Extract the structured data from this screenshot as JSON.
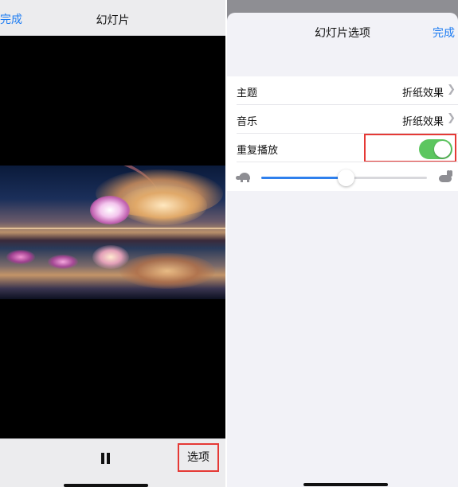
{
  "left": {
    "nav": {
      "done_label": "完成",
      "title": "幻灯片"
    },
    "toolbar": {
      "options_label": "选项"
    }
  },
  "right": {
    "sheet": {
      "title": "幻灯片选项",
      "done_label": "完成"
    },
    "rows": [
      {
        "label": "主题",
        "value": "折纸效果"
      },
      {
        "label": "音乐",
        "value": "折纸效果"
      },
      {
        "label": "重复播放",
        "toggle_on": true
      }
    ],
    "speed_slider": {
      "value_fraction": 0.51
    }
  },
  "colors": {
    "accent": "#1d7cf2",
    "toggle_on": "#5cc65f",
    "highlight_box": "#e53935"
  }
}
